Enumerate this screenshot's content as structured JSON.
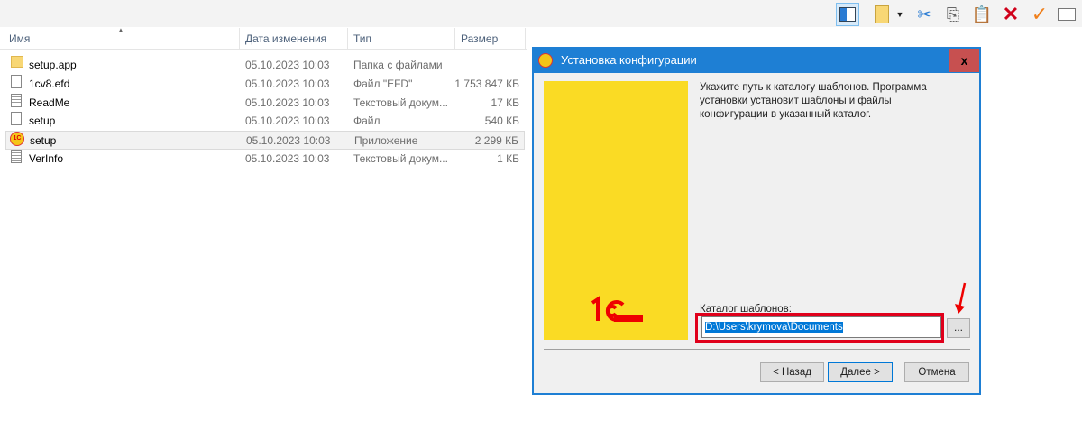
{
  "toolbar": {
    "icons": [
      "preview-pane-icon",
      "properties-icon",
      "cut-icon",
      "copy-icon",
      "paste-icon",
      "delete-icon",
      "check-icon",
      "rename-icon"
    ]
  },
  "columns": {
    "name": "Имя",
    "date": "Дата изменения",
    "type": "Тип",
    "size": "Размер"
  },
  "files": [
    {
      "name": "setup.app",
      "date": "05.10.2023 10:03",
      "type": "Папка с файлами",
      "size": "",
      "icon": "folder-icon"
    },
    {
      "name": "1cv8.efd",
      "date": "05.10.2023 10:03",
      "type": "Файл \"EFD\"",
      "size": "1 753 847 КБ",
      "icon": "file-icon"
    },
    {
      "name": "ReadMe",
      "date": "05.10.2023 10:03",
      "type": "Текстовый докум...",
      "size": "17 КБ",
      "icon": "text-file-icon"
    },
    {
      "name": "setup",
      "date": "05.10.2023 10:03",
      "type": "Файл",
      "size": "540 КБ",
      "icon": "file-icon"
    },
    {
      "name": "setup",
      "date": "05.10.2023 10:03",
      "type": "Приложение",
      "size": "2 299 КБ",
      "icon": "1c-app-icon"
    },
    {
      "name": "VerInfo",
      "date": "05.10.2023 10:03",
      "type": "Текстовый докум...",
      "size": "1 КБ",
      "icon": "text-file-icon"
    }
  ],
  "dialog": {
    "title": "Установка конфигурации",
    "close": "x",
    "description": "Укажите путь к каталогу шаблонов. Программа установки установит шаблоны и файлы конфигурации в указанный каталог.",
    "field_label": "Каталог шаблонов:",
    "field_value": "D:\\Users\\krymova\\Documents",
    "browse": "...",
    "back": "< Назад",
    "next": "Далее >",
    "cancel": "Отмена",
    "logo": "1С"
  },
  "colors": {
    "titlebar": "#1e7fd4",
    "highlight": "#e0001b",
    "logo_bg": "#fadb24"
  }
}
